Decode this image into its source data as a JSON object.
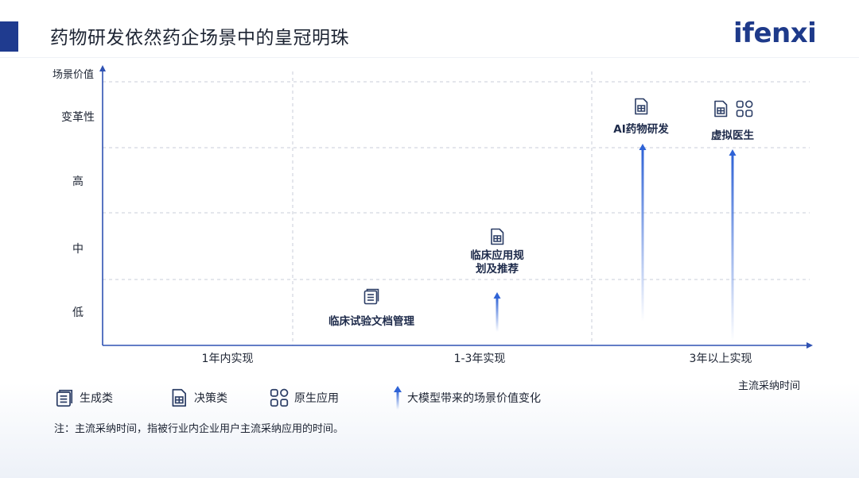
{
  "page": {
    "title": "药物研发依然药企场景中的皇冠明珠",
    "logo": "ifenxi"
  },
  "chart_data": {
    "type": "scatter",
    "ylabel": "场景价值",
    "xlabel": "主流采纳时间",
    "y_levels": [
      "低",
      "中",
      "高",
      "变革性"
    ],
    "x_categories": [
      "1年内实现",
      "1-3年实现",
      "3年以上实现"
    ],
    "points": [
      {
        "label": "临床试验文档管理",
        "x": "1年内实现",
        "y": "低",
        "icons": [
          "document-list-icon"
        ],
        "value_arrow": null
      },
      {
        "label": "临床应用规\n划及推荐",
        "x": "1-3年实现",
        "y": "中",
        "icons": [
          "decision-doc-icon"
        ],
        "value_arrow": {
          "from": "低",
          "to": "低"
        }
      },
      {
        "label": "AI药物研发",
        "x": "3年以上实现",
        "y": "变革性",
        "icons": [
          "decision-doc-icon"
        ],
        "value_arrow": {
          "from": "低",
          "to": "高"
        }
      },
      {
        "label": "虚拟医生",
        "x": "3年以上实现",
        "y": "变革性",
        "icons": [
          "decision-doc-icon",
          "apps-grid-icon"
        ],
        "value_arrow": {
          "from": "低",
          "to": "高"
        }
      }
    ],
    "legend": [
      {
        "icon": "document-list-icon",
        "label": "生成类"
      },
      {
        "icon": "decision-doc-icon",
        "label": "决策类"
      },
      {
        "icon": "apps-grid-icon",
        "label": "原生应用"
      },
      {
        "icon": "value-arrow-icon",
        "label": "大模型带来的场景价值变化"
      }
    ],
    "colors": {
      "axis": "#2f52b3",
      "arrow": "#2f63d6",
      "icon": "#2c3e66",
      "grid": "#c9ced8"
    }
  },
  "footnote": "注：主流采纳时间，指被行业内企业用户主流采纳应用的时间。"
}
